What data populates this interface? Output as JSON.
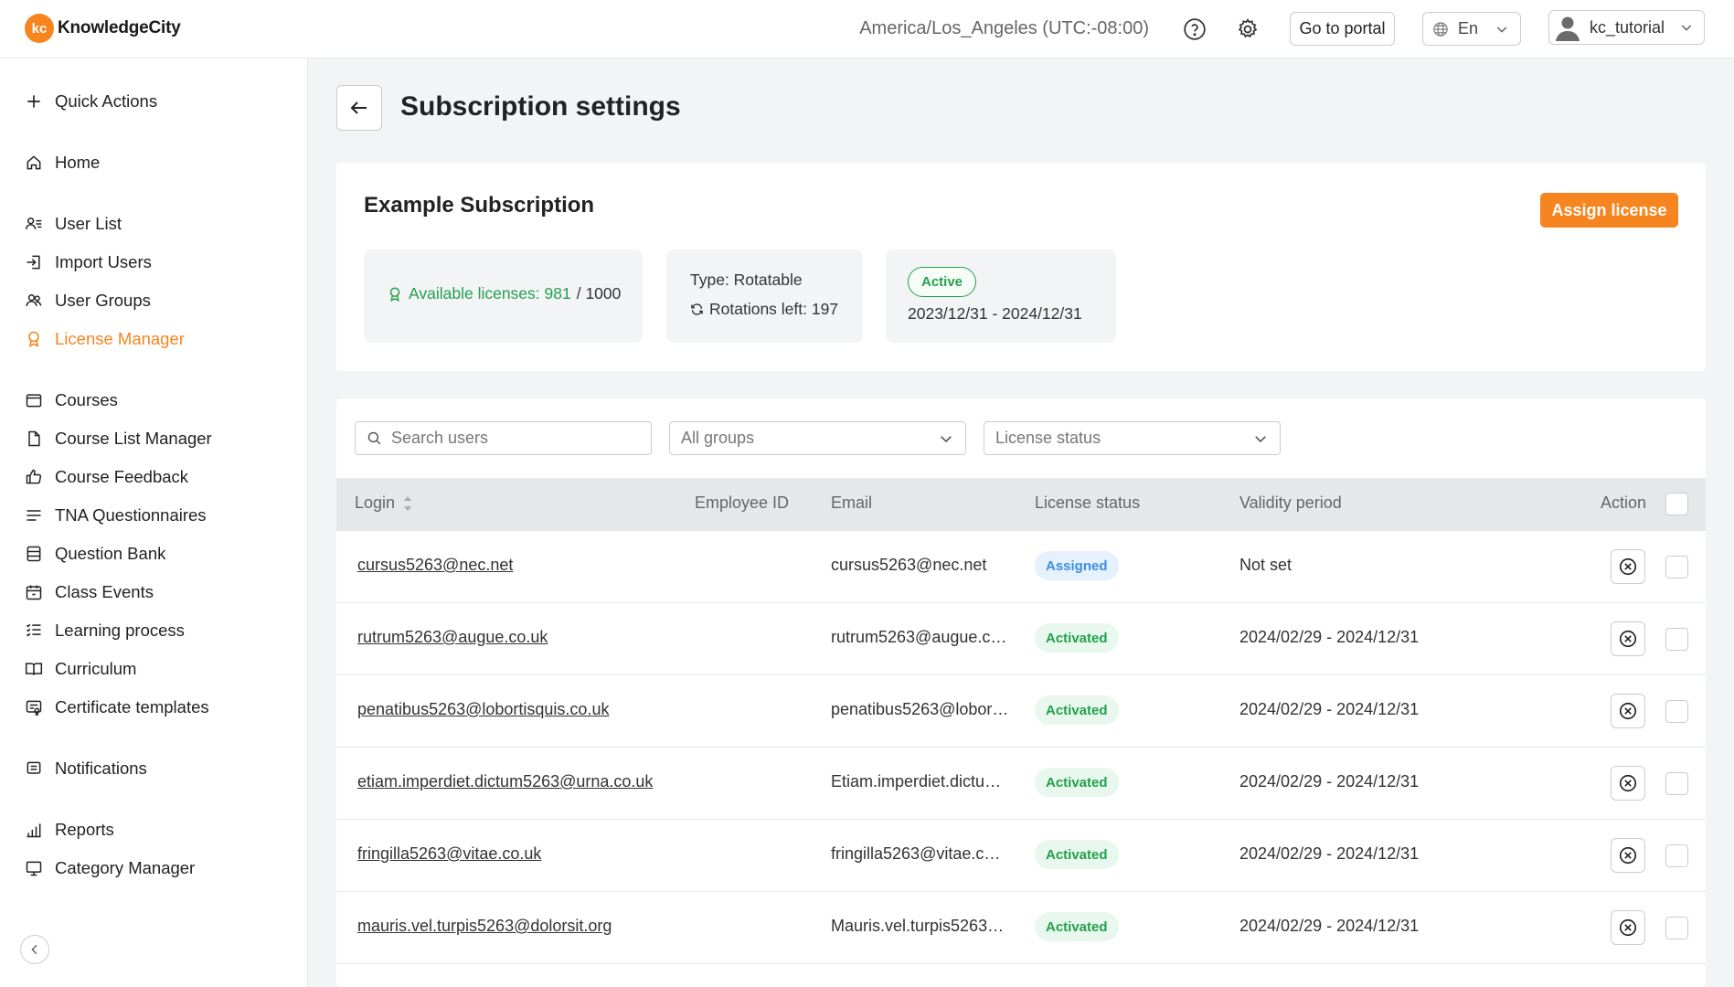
{
  "app": {
    "brand_short": "kc",
    "brand_name": "KnowledgeCity"
  },
  "header": {
    "timezone": "America/Los_Angeles (UTC:-08:00)",
    "portal_label": "Go to portal",
    "language": "En",
    "username": "kc_tutorial"
  },
  "sidebar": {
    "items": [
      {
        "label": "Quick Actions",
        "icon": "plus-icon"
      },
      {
        "label": "Home",
        "icon": "home-icon"
      },
      {
        "label": "User List",
        "icon": "user-list-icon"
      },
      {
        "label": "Import Users",
        "icon": "import-icon"
      },
      {
        "label": "User Groups",
        "icon": "users-icon"
      },
      {
        "label": "License Manager",
        "icon": "badge-icon",
        "active": true
      },
      {
        "label": "Courses",
        "icon": "folder-icon"
      },
      {
        "label": "Course List Manager",
        "icon": "file-icon"
      },
      {
        "label": "Course Feedback",
        "icon": "thumbs-up-icon"
      },
      {
        "label": "TNA Questionnaires",
        "icon": "lines-icon"
      },
      {
        "label": "Question Bank",
        "icon": "list-box-icon"
      },
      {
        "label": "Class Events",
        "icon": "calendar-icon"
      },
      {
        "label": "Learning process",
        "icon": "checklist-icon"
      },
      {
        "label": "Curriculum",
        "icon": "book-icon"
      },
      {
        "label": "Certificate templates",
        "icon": "certificate-icon"
      },
      {
        "label": "Notifications",
        "icon": "message-icon"
      },
      {
        "label": "Reports",
        "icon": "bar-chart-icon"
      },
      {
        "label": "Category Manager",
        "icon": "monitor-icon"
      }
    ]
  },
  "page": {
    "title": "Subscription settings"
  },
  "subscription": {
    "name": "Example Subscription",
    "assign_label": "Assign license",
    "available_label": "Available licenses: 981",
    "total": "/ 1000",
    "type": "Type: Rotatable",
    "rotations": "Rotations left: 197",
    "status": "Active",
    "period": "2023/12/31 - 2024/12/31",
    "accent": "#f7851f"
  },
  "filters": {
    "search_placeholder": "Search users",
    "groups": "All groups",
    "license_status": "License status"
  },
  "table": {
    "headers": {
      "login": "Login",
      "employee_id": "Employee ID",
      "email": "Email",
      "license_status": "License status",
      "validity": "Validity period",
      "action": "Action"
    },
    "rows": [
      {
        "login": "cursus5263@nec.net",
        "email": "cursus5263@nec.net",
        "status": "Assigned",
        "validity": "Not set"
      },
      {
        "login": "rutrum5263@augue.co.uk",
        "email": "rutrum5263@augue.co…",
        "status": "Activated",
        "validity": "2024/02/29 - 2024/12/31"
      },
      {
        "login": "penatibus5263@lobortisquis.co.uk",
        "email": "penatibus5263@lobort…",
        "status": "Activated",
        "validity": "2024/02/29 - 2024/12/31"
      },
      {
        "login": "etiam.imperdiet.dictum5263@urna.co.uk",
        "email": "Etiam.imperdiet.dictu…",
        "status": "Activated",
        "validity": "2024/02/29 - 2024/12/31"
      },
      {
        "login": "fringilla5263@vitae.co.uk",
        "email": "fringilla5263@vitae.co.…",
        "status": "Activated",
        "validity": "2024/02/29 - 2024/12/31"
      },
      {
        "login": "mauris.vel.turpis5263@dolorsit.org",
        "email": "Mauris.vel.turpis5263…",
        "status": "Activated",
        "validity": "2024/02/29 - 2024/12/31"
      }
    ]
  }
}
